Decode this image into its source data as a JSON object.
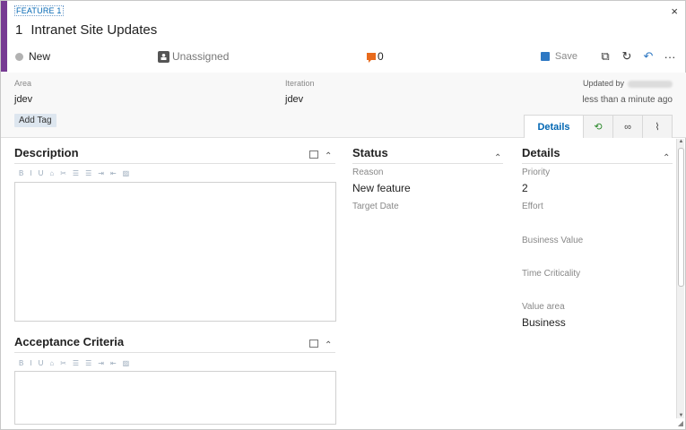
{
  "header": {
    "type_label": "FEATURE 1",
    "id": "1",
    "title": "Intranet Site Updates",
    "close_glyph": "×"
  },
  "status_row": {
    "state": "New",
    "assigned": "Unassigned",
    "comment_count": "0"
  },
  "toolbar": {
    "save_label": "Save",
    "more_glyph": "···",
    "refresh_glyph": "↻",
    "undo_glyph": "↶",
    "clone_glyph": "⧉"
  },
  "band": {
    "area_label": "Area",
    "area_value": "jdev",
    "iteration_label": "Iteration",
    "iteration_value": "jdev",
    "updated_by_label": "Updated by",
    "updated_time": "less than a minute ago",
    "add_tag": "Add Tag"
  },
  "tabs": {
    "details": "Details",
    "history_glyph": "⟲",
    "links_glyph": "∞",
    "attachments_glyph": "⌇"
  },
  "description": {
    "title": "Description",
    "toolbar": [
      "B",
      "I",
      "U",
      "⌂",
      "✂",
      "☰",
      "☰",
      "⇥",
      "⇤",
      "▨"
    ]
  },
  "acceptance": {
    "title": "Acceptance Criteria",
    "toolbar": [
      "B",
      "I",
      "U",
      "⌂",
      "✂",
      "☰",
      "☰",
      "⇥",
      "⇤",
      "▨"
    ]
  },
  "status_section": {
    "title": "Status",
    "reason_label": "Reason",
    "reason_value": "New feature",
    "target_date_label": "Target Date"
  },
  "details_section": {
    "title": "Details",
    "priority_label": "Priority",
    "priority_value": "2",
    "effort_label": "Effort",
    "business_value_label": "Business Value",
    "time_criticality_label": "Time Criticality",
    "value_area_label": "Value area",
    "value_area_value": "Business"
  },
  "colors": {
    "accent": "#773b93",
    "link": "#0066b3",
    "comment": "#e86a1c"
  }
}
